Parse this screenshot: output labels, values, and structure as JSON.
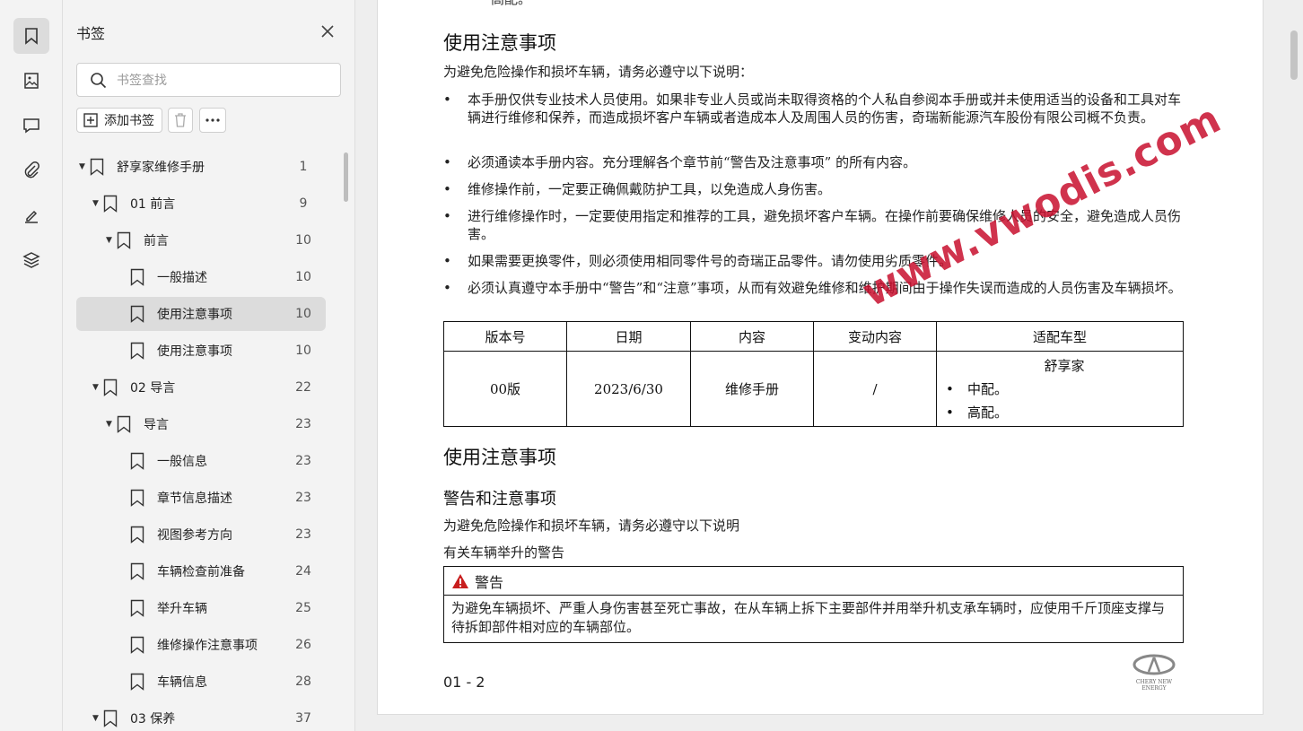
{
  "panel": {
    "title": "书签",
    "search_placeholder": "书签查找",
    "add_label": "添加书签"
  },
  "tree": [
    {
      "label": "舒享家维修手册",
      "page": "1",
      "level": 0,
      "expanded": true
    },
    {
      "label": "01 前言",
      "page": "9",
      "level": 1,
      "expanded": true
    },
    {
      "label": "前言",
      "page": "10",
      "level": 2,
      "expanded": true
    },
    {
      "label": "一般描述",
      "page": "10",
      "level": 3
    },
    {
      "label": "使用注意事项",
      "page": "10",
      "level": 3,
      "selected": true
    },
    {
      "label": "使用注意事项",
      "page": "10",
      "level": 3
    },
    {
      "label": "02 导言",
      "page": "22",
      "level": 1,
      "expanded": true
    },
    {
      "label": "导言",
      "page": "23",
      "level": 2,
      "expanded": true
    },
    {
      "label": "一般信息",
      "page": "23",
      "level": 3
    },
    {
      "label": "章节信息描述",
      "page": "23",
      "level": 3
    },
    {
      "label": "视图参考方向",
      "page": "23",
      "level": 3
    },
    {
      "label": "车辆检查前准备",
      "page": "24",
      "level": 3
    },
    {
      "label": "举升车辆",
      "page": "25",
      "level": 3
    },
    {
      "label": "维修操作注意事项",
      "page": "26",
      "level": 3
    },
    {
      "label": "车辆信息",
      "page": "28",
      "level": 3
    },
    {
      "label": "03 保养",
      "page": "37",
      "level": 1,
      "expanded": true
    }
  ],
  "doc": {
    "top_fragment": "高配。",
    "section1_title": "使用注意事项",
    "intro": "为避免危险操作和损坏车辆，请务必遵守以下说明：",
    "bullets": [
      "本手册仅供专业技术人员使用。如果非专业人员或尚未取得资格的个人私自参阅本手册或并未使用适当的设备和工具对车辆进行维修和保养，而造成损坏客户车辆或者造成本人及周围人员的伤害，奇瑞新能源汽车股份有限公司概不负责。",
      "必须通读本手册内容。充分理解各个章节前“警告及注意事项” 的所有内容。",
      "维修操作前，一定要正确佩戴防护工具，以免造成人身伤害。",
      "进行维修操作时，一定要使用指定和推荐的工具，避免损坏客户车辆。在操作前要确保维修人员的安全，避免造成人员伤害。",
      "如果需要更换零件，则必须使用相同零件号的奇瑞正品零件。请勿使用劣质零件。",
      "必须认真遵守本手册中“警告”和“注意”事项，从而有效避免维修和维护期间由于操作失误而造成的人员伤害及车辆损坏。"
    ],
    "table": {
      "headers": [
        "版本号",
        "日期",
        "内容",
        "变动内容",
        "适配车型"
      ],
      "row": [
        "00版",
        "2023/6/30",
        "维修手册",
        "/"
      ],
      "model_header": "舒享家",
      "models": [
        "中配。",
        "高配。"
      ]
    },
    "section2_title": "使用注意事项",
    "subsection_title": "警告和注意事项",
    "intro2": "为避免危险操作和损坏车辆，请务必遵守以下说明",
    "lift_title": "有关车辆举升的警告",
    "warning_label": "警告",
    "warning_text": "为避免车辆损坏、严重人身伤害甚至死亡事故，在从车辆上拆下主要部件并用举升机支承车辆时，应使用千斤顶座支撑与待拆卸部件相对应的车辆部位。",
    "page_number": "01 - 2",
    "logo_text": "CHERY NEW ENERGY",
    "watermark": "www.vwodis.com"
  }
}
